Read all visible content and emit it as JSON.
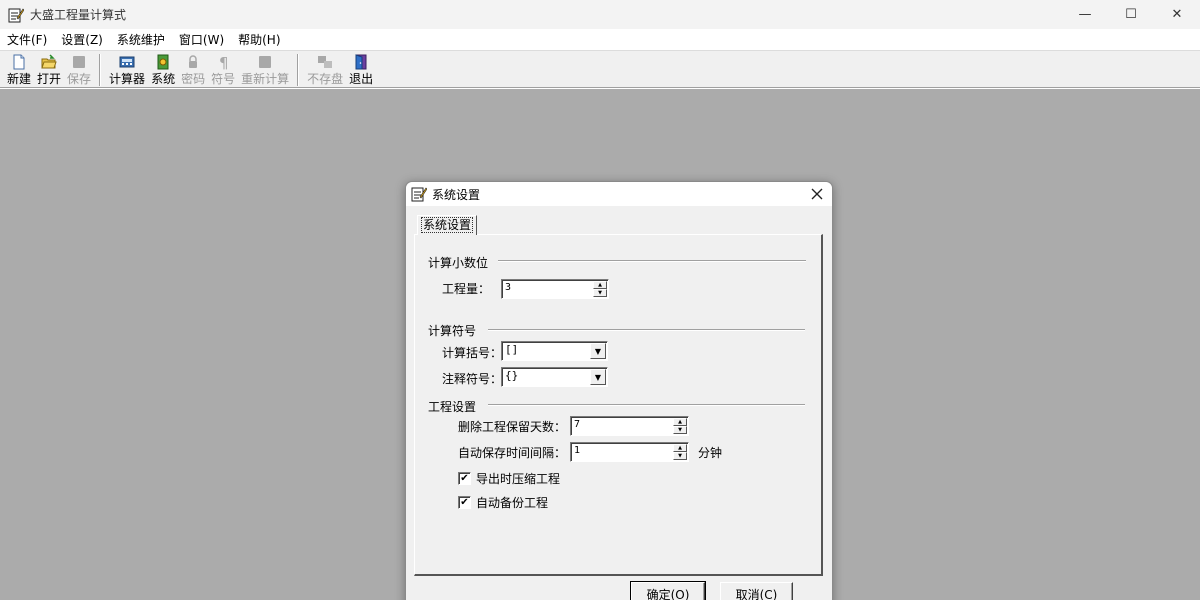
{
  "app": {
    "title": "大盛工程量计算式"
  },
  "window_controls": {
    "minimize": "—",
    "maximize": "☐",
    "close": "✕"
  },
  "menu": {
    "items": [
      {
        "label": "文件(F)"
      },
      {
        "label": "设置(Z)"
      },
      {
        "label": "系统维护"
      },
      {
        "label": "窗口(W)"
      },
      {
        "label": "帮助(H)"
      }
    ]
  },
  "toolbar": {
    "items": [
      {
        "label": "新建",
        "icon": "new-document-icon",
        "enabled": true
      },
      {
        "label": "打开",
        "icon": "open-folder-icon",
        "enabled": true
      },
      {
        "label": "保存",
        "icon": "save-icon",
        "enabled": false
      },
      {
        "label": "计算器",
        "icon": "calculator-icon",
        "enabled": true
      },
      {
        "label": "系统",
        "icon": "system-icon",
        "enabled": true
      },
      {
        "label": "密码",
        "icon": "lock-icon",
        "enabled": false
      },
      {
        "label": "符号",
        "icon": "pilcrow-icon",
        "enabled": false
      },
      {
        "label": "重新计算",
        "icon": "recalc-icon",
        "enabled": false
      },
      {
        "label": "不存盘",
        "icon": "no-save-icon",
        "enabled": false
      },
      {
        "label": "退出",
        "icon": "exit-door-icon",
        "enabled": true
      }
    ]
  },
  "dialog": {
    "title": "系统设置",
    "tab_label": "系统设置",
    "groups": {
      "decimal": {
        "label": "计算小数位",
        "quantity_label": "工程量：",
        "quantity_value": "3"
      },
      "symbols": {
        "label": "计算符号",
        "bracket_label": "计算括号：",
        "bracket_value": "[]",
        "comment_label": "注释符号：",
        "comment_value": "{}"
      },
      "project": {
        "label": "工程设置",
        "delete_days_label": "删除工程保留天数：",
        "delete_days_value": "7",
        "autosave_label": "自动保存时间间隔：",
        "autosave_value": "1",
        "autosave_unit": "分钟",
        "compress_label": "导出时压缩工程",
        "compress_checked": true,
        "backup_label": "自动备份工程",
        "backup_checked": true
      }
    },
    "ok_label": "确定(O)",
    "cancel_label": "取消(C)",
    "check_mark": "✔"
  }
}
